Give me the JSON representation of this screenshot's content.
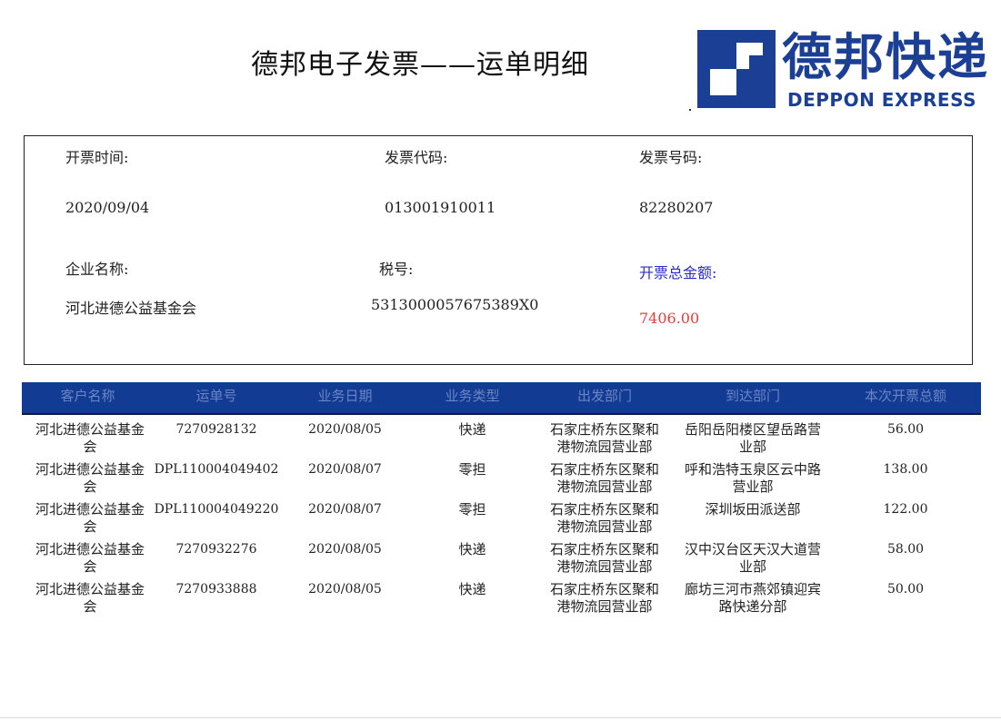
{
  "title": "德邦电子发票——运单明细",
  "logo": {
    "cn": "德邦快递",
    "en": "DEPPON EXPRESS"
  },
  "info": {
    "issue_time_label": "开票时间:",
    "issue_time": "2020/09/04",
    "invoice_code_label": "发票代码:",
    "invoice_code": "013001910011",
    "invoice_no_label": "发票号码:",
    "invoice_no": "82280207",
    "company_label": "企业名称:",
    "company": "河北进德公益基金会",
    "tax_label": "税号:",
    "tax_no": "5313000057675389X0",
    "total_label": "开票总金额:",
    "total": "7406.00"
  },
  "table": {
    "headers": [
      "客户名称",
      "运单号",
      "业务日期",
      "业务类型",
      "出发部门",
      "到达部门",
      "本次开票总额"
    ],
    "rows": [
      {
        "customer_1": "河北进德公益基金",
        "customer_2": "会",
        "waybill": "7270928132",
        "date": "2020/08/05",
        "type": "快递",
        "from_1": "石家庄桥东区聚和",
        "from_2": "港物流园营业部",
        "to_1": "岳阳岳阳楼区望岳路营",
        "to_2": "业部",
        "amount": "56.00"
      },
      {
        "customer_1": "河北进德公益基金",
        "customer_2": "会",
        "waybill": "DPL110004049402",
        "date": "2020/08/07",
        "type": "零担",
        "from_1": "石家庄桥东区聚和",
        "from_2": "港物流园营业部",
        "to_1": "呼和浩特玉泉区云中路",
        "to_2": "营业部",
        "amount": "138.00"
      },
      {
        "customer_1": "河北进德公益基金",
        "customer_2": "会",
        "waybill": "DPL110004049220",
        "date": "2020/08/07",
        "type": "零担",
        "from_1": "石家庄桥东区聚和",
        "from_2": "港物流园营业部",
        "to_1": "深圳坂田派送部",
        "to_2": "",
        "amount": "122.00"
      },
      {
        "customer_1": "河北进德公益基金",
        "customer_2": "会",
        "waybill": "7270932276",
        "date": "2020/08/05",
        "type": "快递",
        "from_1": "石家庄桥东区聚和",
        "from_2": "港物流园营业部",
        "to_1": "汉中汉台区天汉大道营",
        "to_2": "业部",
        "amount": "58.00"
      },
      {
        "customer_1": "河北进德公益基金",
        "customer_2": "会",
        "waybill": "7270933888",
        "date": "2020/08/05",
        "type": "快递",
        "from_1": "石家庄桥东区聚和",
        "from_2": "港物流园营业部",
        "to_1": "廊坊三河市燕郊镇迎宾",
        "to_2": "路快递分部",
        "amount": "50.00"
      }
    ]
  },
  "colors": {
    "brand_blue": "#1a3f95",
    "header_bg": "#123b93",
    "total_label": "#2a2ad0",
    "total_value": "#e0403a"
  }
}
